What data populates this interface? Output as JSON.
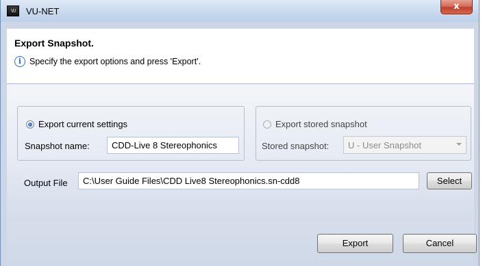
{
  "window": {
    "title": "VU-NET",
    "app_icon_text": "VU",
    "close_glyph": "x"
  },
  "header": {
    "title": "Export Snapshot.",
    "info_icon": "i",
    "subtitle": "Specify the export options and press 'Export'."
  },
  "export_current": {
    "radio_label": "Export current settings",
    "selected": true,
    "snapshot_name_label": "Snapshot name:",
    "snapshot_name_value": "CDD-Live 8 Stereophonics"
  },
  "export_stored": {
    "radio_label": "Export stored snapshot",
    "selected": false,
    "stored_snapshot_label": "Stored snapshot:",
    "stored_snapshot_value": "U - User Snapshot"
  },
  "output": {
    "label": "Output File",
    "value": "C:\\User Guide Files\\CDD Live8 Stereophonics.sn-cdd8",
    "select_button": "Select"
  },
  "buttons": {
    "export": "Export",
    "cancel": "Cancel"
  },
  "icons": {
    "app": "vu-net-app-icon",
    "close": "close-icon",
    "info": "info-icon",
    "dropdown": "chevron-down-icon"
  }
}
